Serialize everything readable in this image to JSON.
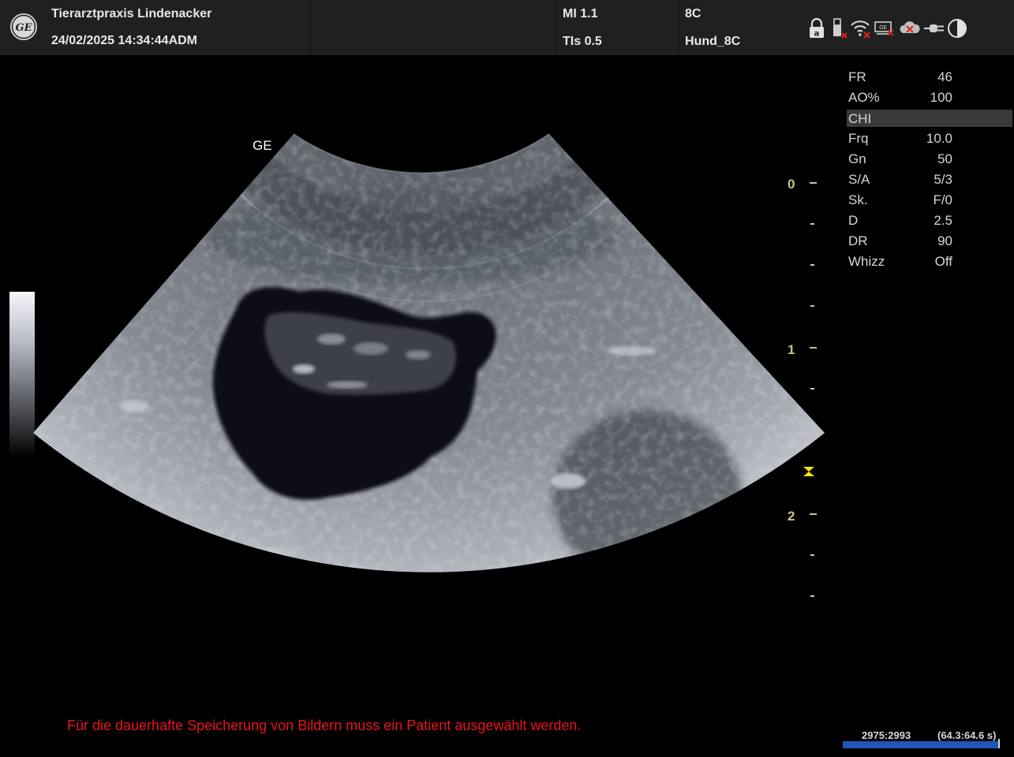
{
  "header": {
    "clinic_name": "Tierarztpraxis Lindenacker",
    "datetime": "24/02/2025 14:34:44ADM",
    "mi": "MI 1.1",
    "tis": "TIs 0.5",
    "probe": "8C",
    "preset": "Hund_8C",
    "logo_text": "GE",
    "status_icons": [
      "lock-icon",
      "usb-disconnected-icon",
      "wifi-disconnected-icon",
      "network-printer-icon",
      "cloud-disconnected-icon",
      "power-plug-icon",
      "contrast-icon"
    ]
  },
  "image": {
    "orientation_marker": "GE"
  },
  "depth_scale": {
    "labels": [
      "0",
      "1",
      "2"
    ],
    "unit": "cm",
    "focus_depth": 1.75
  },
  "parameters": [
    {
      "name": "FR",
      "value": "46"
    },
    {
      "name": "AO%",
      "value": "100"
    },
    {
      "name": "CHI",
      "value": "",
      "section": true
    },
    {
      "name": "Frq",
      "value": "10.0"
    },
    {
      "name": "Gn",
      "value": "50"
    },
    {
      "name": "S/A",
      "value": "5/3"
    },
    {
      "name": "Sk.",
      "value": "F/0"
    },
    {
      "name": "D",
      "value": "2.5"
    },
    {
      "name": "DR",
      "value": "90"
    },
    {
      "name": "Whizz",
      "value": "Off"
    }
  ],
  "warning_message": "Für die dauerhafte Speicherung von Bildern muss ein Patient ausgewählt werden.",
  "cine": {
    "frame_counter": "2975:2993",
    "time_counter": "(64.3:64.6 s)",
    "progress": 0.99
  },
  "colors": {
    "warning": "#e8141a",
    "depth_label": "#c8c48a",
    "focus_marker": "#f2e600",
    "cine_bar": "#1e56b8"
  }
}
